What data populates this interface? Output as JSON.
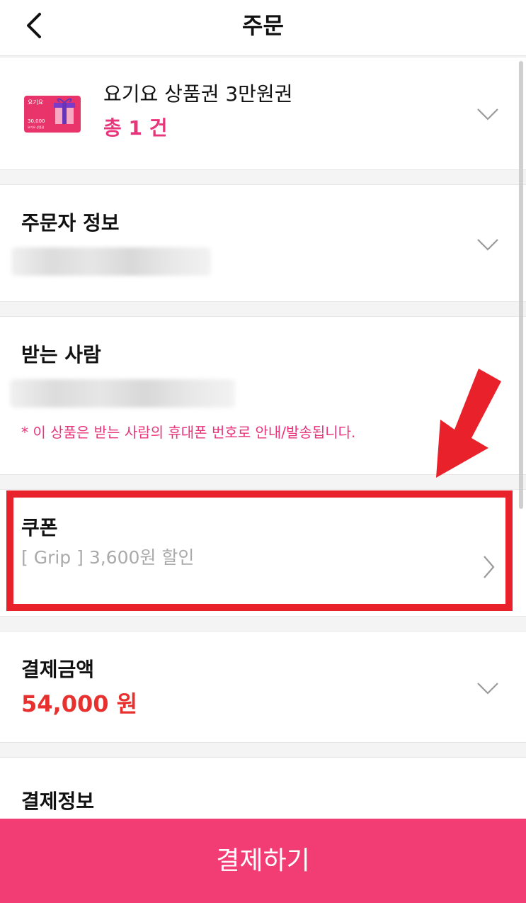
{
  "header": {
    "title": "주문"
  },
  "product": {
    "name": "요기요 상품권 3만원권",
    "count": "총 1 건",
    "thumbnail": {
      "brand": "요기요",
      "amount": "30,000",
      "caption": "요기요 상품권"
    }
  },
  "orderer": {
    "title": "주문자 정보"
  },
  "recipient": {
    "title": "받는 사람",
    "note": "* 이 상품은 받는 사람의 휴대폰 번호로 안내/발송됩니다."
  },
  "coupon": {
    "title": "쿠폰",
    "value": "[ Grip ] 3,600원 할인"
  },
  "payment_amount": {
    "title": "결제금액",
    "amount": "54,000 원"
  },
  "payment_info": {
    "title": "결제정보"
  },
  "pay_button": {
    "label": "결제하기"
  },
  "colors": {
    "accent_pink": "#e8347a",
    "amount_red": "#e7312f",
    "annotation_red": "#e8212a",
    "button_bg": "#f23c74",
    "placeholder_gray": "#aaaaaa"
  },
  "icons": [
    "back-arrow-icon",
    "chevron-down-icon",
    "chevron-right-icon",
    "gift-card-icon",
    "red-arrow-annotation"
  ]
}
